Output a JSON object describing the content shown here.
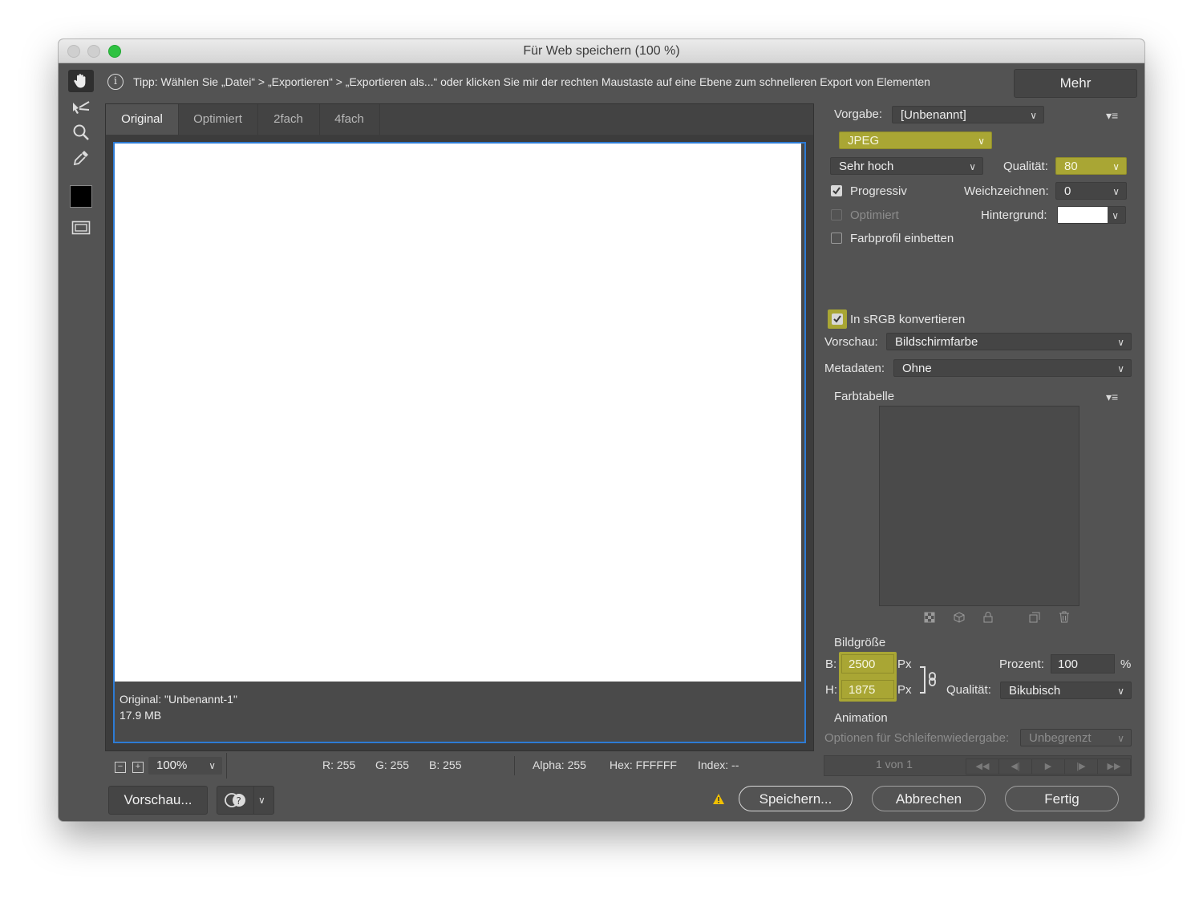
{
  "window": {
    "title": "Für Web speichern (100 %)"
  },
  "tipbar": {
    "tip": "Tipp: Wählen Sie „Datei“ > „Exportieren“ > „Exportieren als...“ oder klicken Sie mir der rechten Maustaste auf eine Ebene zum schnelleren Export von Elementen",
    "more_label": "Mehr"
  },
  "tools": [
    "hand-icon",
    "slice-select-icon",
    "zoom-icon",
    "eyedropper-icon",
    "color-swatch",
    "slices-toggle-icon"
  ],
  "view": {
    "tabs": [
      {
        "label": "Original",
        "active": true
      },
      {
        "label": "Optimiert",
        "active": false
      },
      {
        "label": "2fach",
        "active": false
      },
      {
        "label": "4fach",
        "active": false
      }
    ],
    "caption_name": "Original: \"Unbenannt-1\"",
    "caption_size": "17.9 MB"
  },
  "status": {
    "zoom": "100%",
    "r": "R: 255",
    "g": "G: 255",
    "b": "B: 255",
    "alpha": "Alpha: 255",
    "hex": "Hex: FFFFFF",
    "index": "Index: --"
  },
  "settings": {
    "preset_label": "Vorgabe:",
    "preset_value": "[Unbenannt]",
    "format": "JPEG",
    "quality_preset": "Sehr hoch",
    "quality_label": "Qualität:",
    "quality_value": "80",
    "progressive_label": "Progressiv",
    "progressive_checked": true,
    "blur_label": "Weichzeichnen:",
    "blur_value": "0",
    "optimized_label": "Optimiert",
    "optimized_checked": false,
    "matte_label": "Hintergrund:",
    "matte_color": "#ffffff",
    "embed_profile_label": "Farbprofil einbetten",
    "embed_profile_checked": false,
    "srgb_label": "In sRGB konvertieren",
    "srgb_checked": true,
    "preview_label": "Vorschau:",
    "preview_value": "Bildschirmfarbe",
    "metadata_label": "Metadaten:",
    "metadata_value": "Ohne",
    "color_table_label": "Farbtabelle"
  },
  "image_size": {
    "heading": "Bildgröße",
    "w_label": "B:",
    "w_value": "2500",
    "h_label": "H:",
    "h_value": "1875",
    "unit": "Px",
    "percent_label": "Prozent:",
    "percent_value": "100",
    "percent_unit": "%",
    "quality_label": "Qualität:",
    "quality_value": "Bikubisch"
  },
  "animation": {
    "heading": "Animation",
    "loop_label": "Optionen für Schleifenwiedergabe:",
    "loop_value": "Unbegrenzt",
    "frame_counter": "1 von 1"
  },
  "buttons": {
    "preview": "Vorschau...",
    "save": "Speichern...",
    "cancel": "Abbrechen",
    "done": "Fertig"
  },
  "colors": {
    "accent_olive": "#a9a634",
    "selection_blue": "#2d7bd4",
    "panel_bg": "#535353"
  }
}
